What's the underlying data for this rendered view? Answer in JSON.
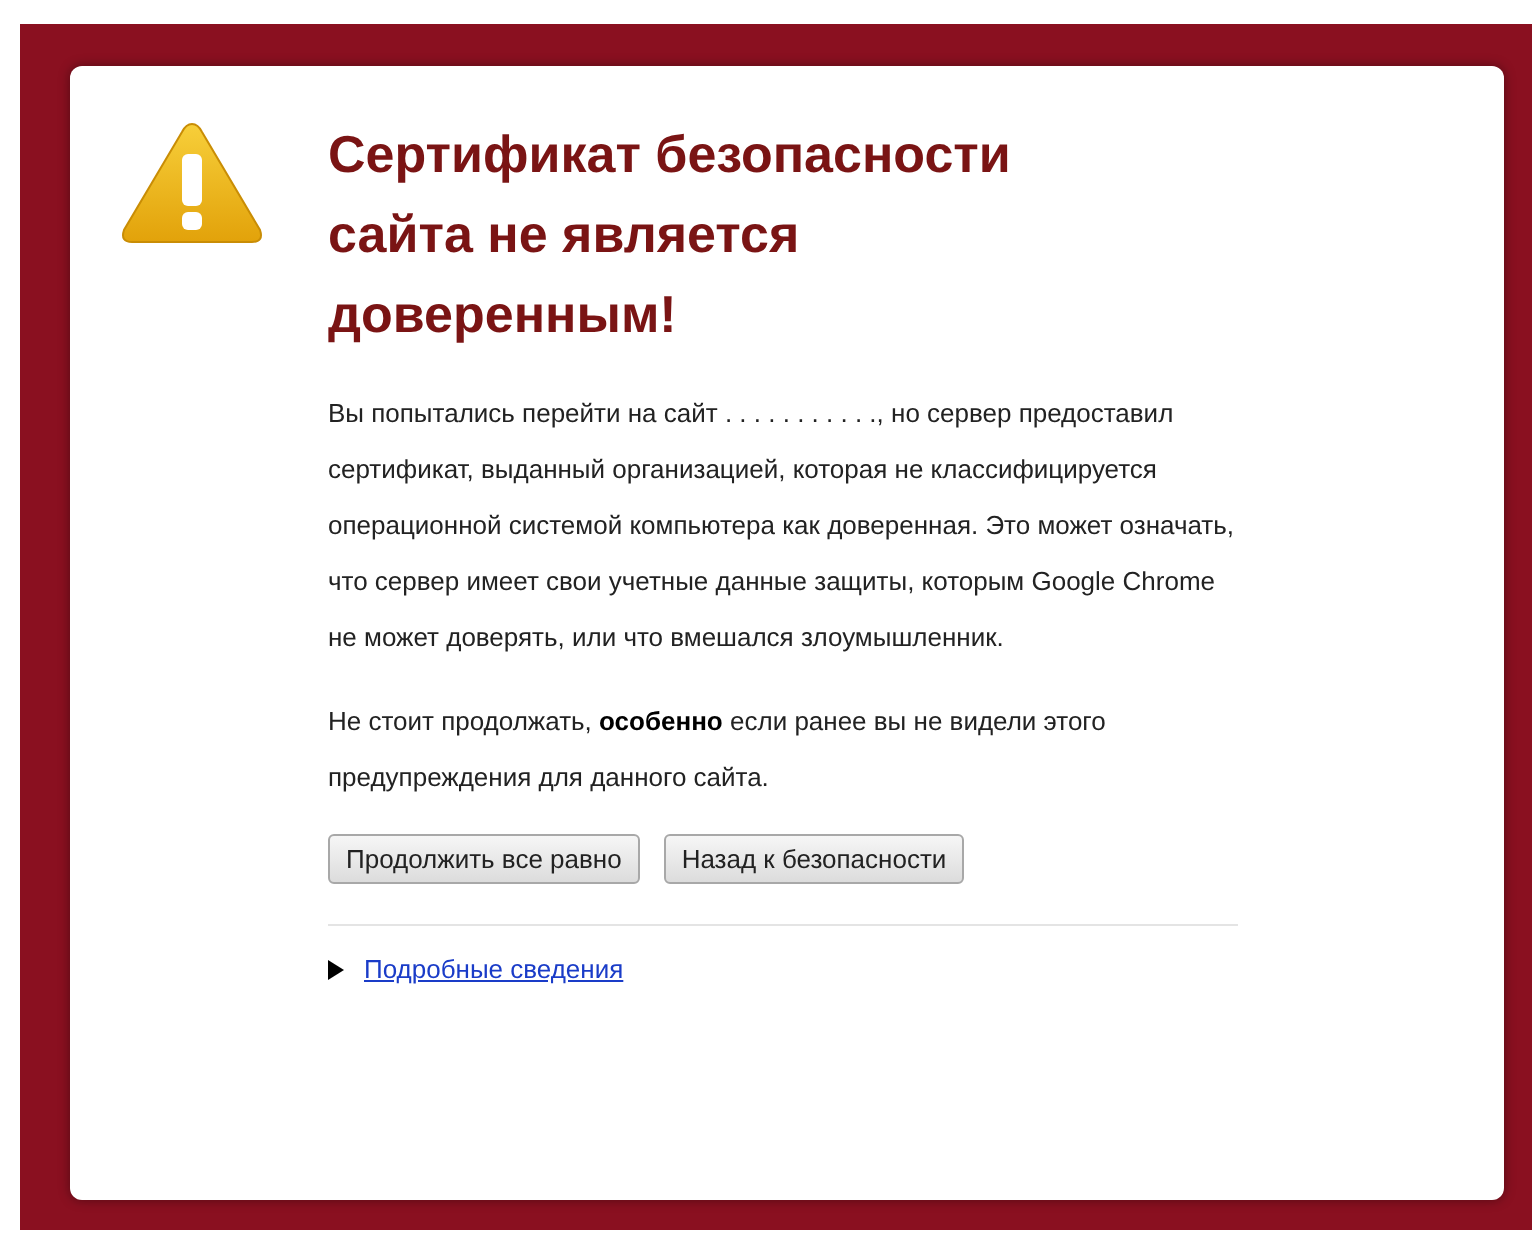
{
  "title": "Сертификат безопасности сайта не является доверенным!",
  "paragraphs": [
    "Вы попытались перейти на сайт . . . . . . .  . .  . ., но сервер предоставил сертификат, выданный организацией, которая не классифицируется операционной системой компьютера как доверенная. Это может означать, что сервер имеет свои учетные данные защиты, которым Google Chrome не может доверять, или что вмешался злоумышленник.",
    "Не стоит продолжать, **особенно** если ранее вы не видели этого предупреждения для данного сайта."
  ],
  "buttons": [
    "Продолжить все равно",
    "Назад к безопасности"
  ],
  "details": {
    "label": "Подробные сведения",
    "expanded": false
  }
}
